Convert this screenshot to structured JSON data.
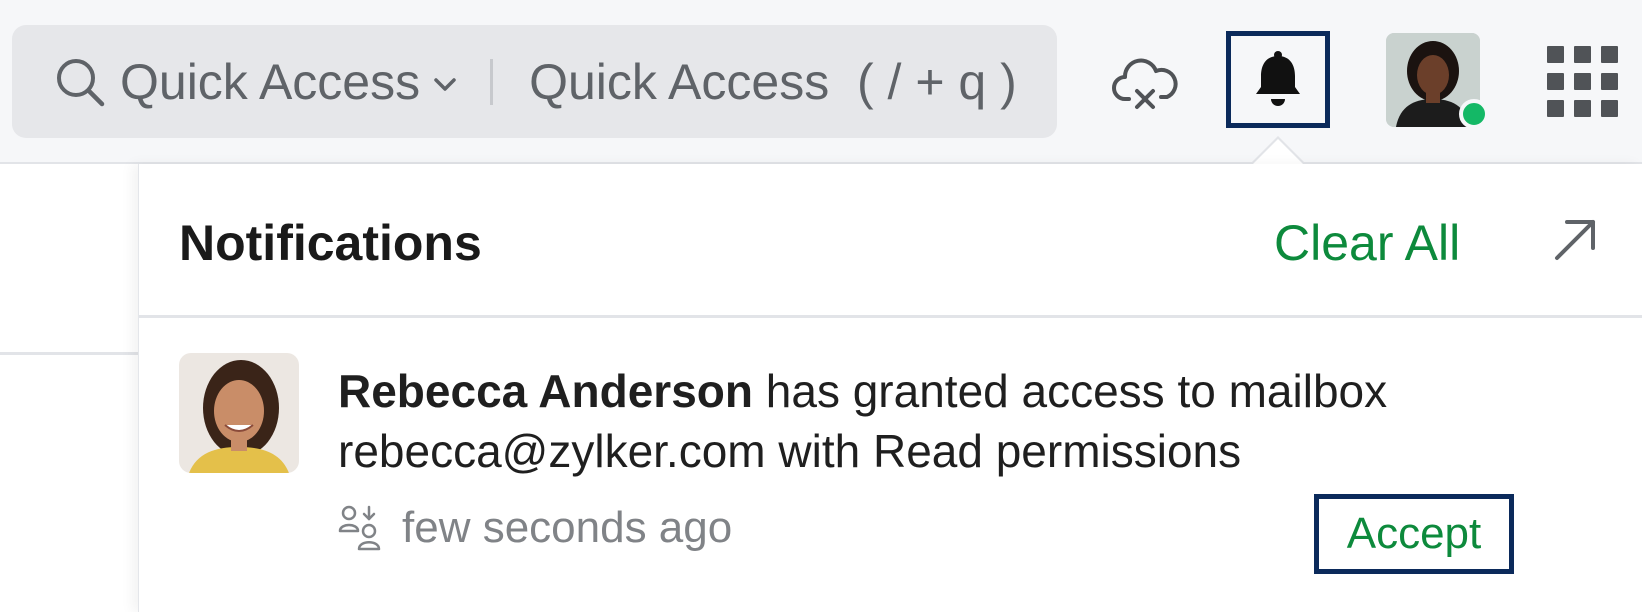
{
  "header": {
    "search": {
      "mode_label": "Quick Access",
      "placeholder": "Quick Access  ( / + q )"
    },
    "icons": {
      "search": "search-icon",
      "mode_dropdown": "chevron-down-icon",
      "offline": "cloud-offline-icon",
      "notifications": "bell-icon",
      "apps": "app-grid-icon"
    },
    "user_status_color": "#14b866"
  },
  "notifications": {
    "title": "Notifications",
    "clear_all_label": "Clear All",
    "expand_icon": "expand-arrow-icon",
    "items": [
      {
        "sender": "Rebecca Anderson",
        "message": " has granted access to mailbox rebecca@zylker.com with Read permissions",
        "time": "few seconds ago",
        "type_icon": "delegate-access-icon",
        "action_label": "Accept"
      }
    ]
  },
  "colors": {
    "accent_green": "#0d8a3c",
    "highlight_border": "#0b2a5b"
  }
}
